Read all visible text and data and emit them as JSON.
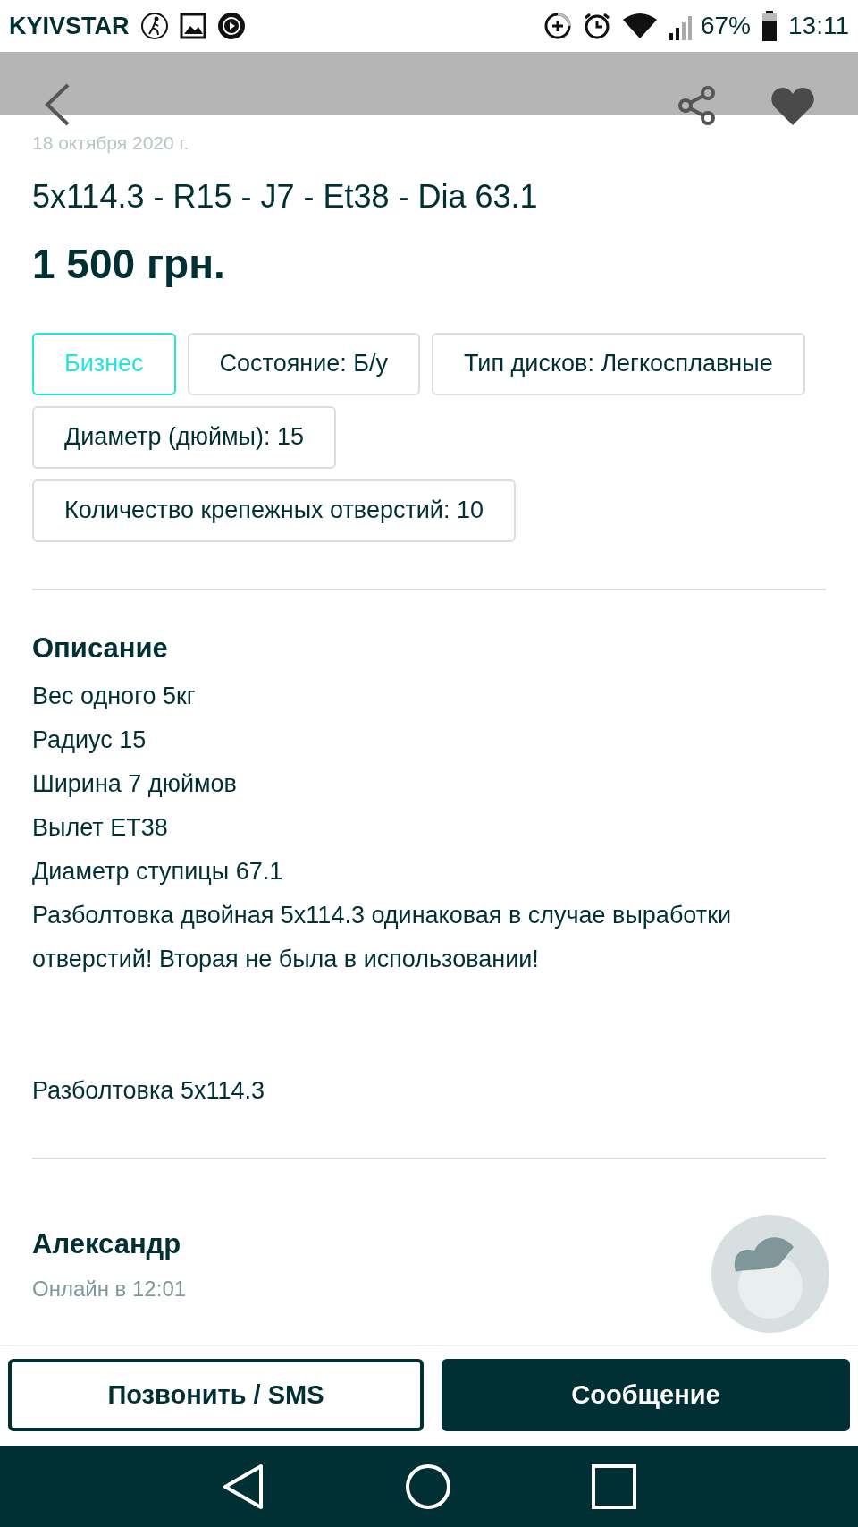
{
  "status_bar": {
    "carrier": "KYIVSTAR",
    "battery_text": "67%",
    "time": "13:11"
  },
  "date": "18 октября 2020 г.",
  "title": "5x114.3 - R15 - J7 - Et38 - Dia 63.1",
  "price": "1 500 грн.",
  "params": [
    {
      "label": "Бизнес",
      "kind": "business"
    },
    {
      "label": "Состояние: Б/у",
      "kind": "param"
    },
    {
      "label": "Тип дисков: Легкосплавные",
      "kind": "param"
    },
    {
      "label": "Диаметр (дюймы): 15",
      "kind": "param"
    },
    {
      "label": "Количество крепежных отверстий: 10",
      "kind": "param"
    }
  ],
  "description": {
    "heading": "Описание",
    "paragraphs": [
      [
        "Вес одного 5кг",
        "Радиус 15",
        "Ширина 7 дюймов",
        "Вылет ET38",
        "Диаметр ступицы 67.1",
        "Разболтовка двойная 5x114.3 одинаковая в случае выработки отверстий! Вторая не была в использовании!"
      ],
      [
        "Разболтовка 5x114.3"
      ]
    ]
  },
  "seller": {
    "name": "Александр",
    "last_seen": "Онлайн в 12:01"
  },
  "buttons": [
    {
      "label": "Позвонить / SMS",
      "kind": "outline"
    },
    {
      "label": "Сообщение",
      "kind": "solid"
    }
  ]
}
